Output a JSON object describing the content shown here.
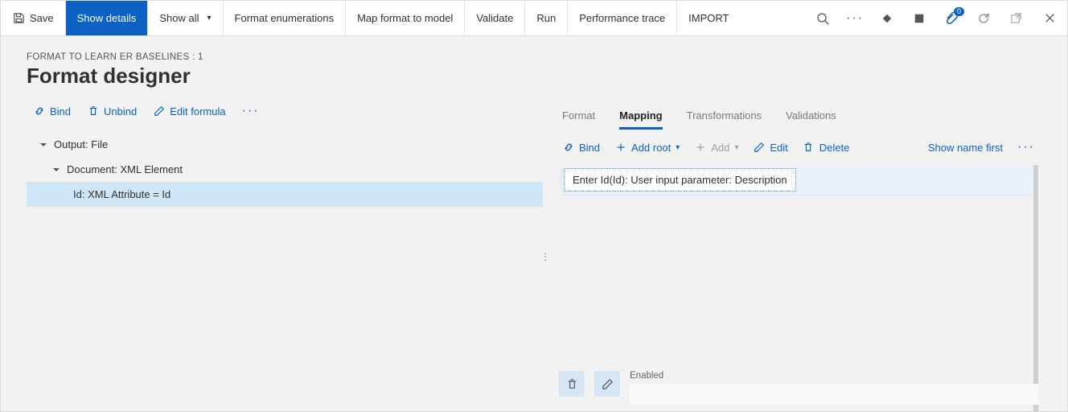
{
  "cmdbar": {
    "save": "Save",
    "show_details": "Show details",
    "show_all": "Show all",
    "format_enum": "Format enumerations",
    "map_format": "Map format to model",
    "validate": "Validate",
    "run": "Run",
    "perf_trace": "Performance trace",
    "import": "IMPORT",
    "badge_count": "0"
  },
  "header": {
    "breadcrumb": "FORMAT TO LEARN ER BASELINES : 1",
    "title": "Format designer"
  },
  "left_toolbar": {
    "bind": "Bind",
    "unbind": "Unbind",
    "edit_formula": "Edit formula"
  },
  "tree": {
    "row1": "Output: File",
    "row2": "Document: XML Element",
    "row3": "Id: XML Attribute = Id"
  },
  "tabs": {
    "format": "Format",
    "mapping": "Mapping",
    "transformations": "Transformations",
    "validations": "Validations"
  },
  "right_toolbar": {
    "bind": "Bind",
    "add_root": "Add root",
    "add": "Add",
    "edit": "Edit",
    "delete": "Delete",
    "show_name_first": "Show name first"
  },
  "mapping_item": "Enter Id(Id): User input parameter: Description",
  "bottom": {
    "enabled_label": "Enabled",
    "enabled_value": ""
  }
}
